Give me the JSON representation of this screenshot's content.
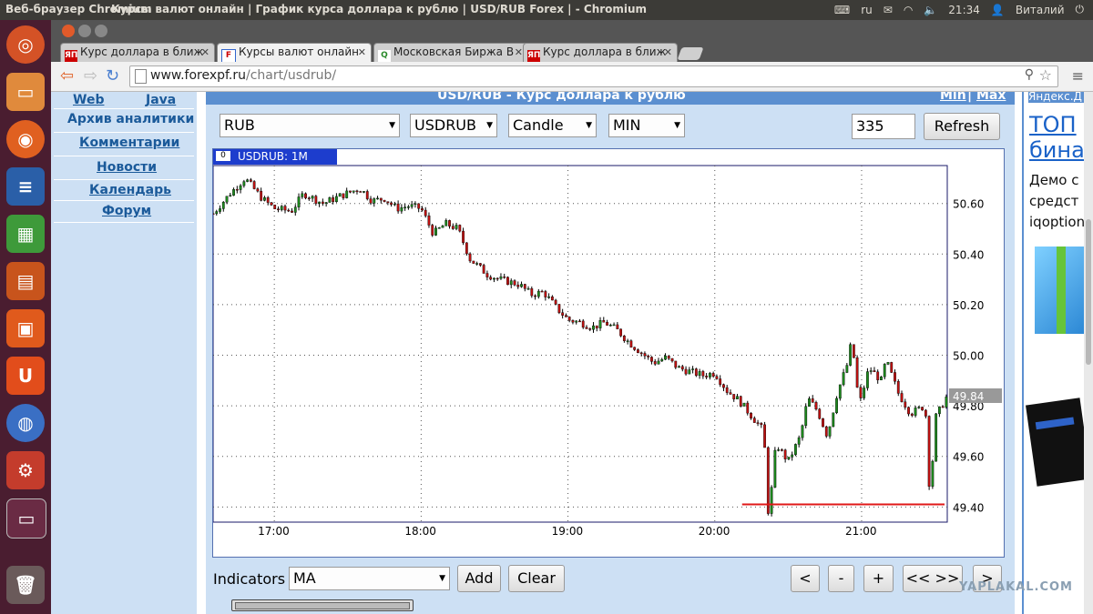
{
  "system_bar": {
    "app_name": "Веб-браузер Chromium",
    "window_title": "Курсы валют онлайн | График курса доллара к рублю | USD/RUB Forex | - Chromium",
    "keyboard_layout": "ru",
    "time": "21:34",
    "user": "Виталий"
  },
  "tabs": [
    {
      "favicon": "ЯП",
      "label": "Курс доллара в ближ",
      "active": false
    },
    {
      "favicon": "F",
      "label": "Курсы валют онлайн",
      "active": true
    },
    {
      "favicon": "Q",
      "label": "Московская Биржа В",
      "active": false
    },
    {
      "favicon": "ЯП",
      "label": "Курс доллара в ближ",
      "active": false
    }
  ],
  "address": {
    "domain": "www.forexpf.ru",
    "path": "/chart/usdrub/"
  },
  "left_nav": {
    "tab_web": "Web",
    "tab_java": "Java",
    "items": [
      "Архив аналитики",
      "Комментарии",
      "Новости",
      "Календарь",
      "Форум"
    ]
  },
  "chart_header": {
    "title": "USD/RUB - Курс доллара к рублю",
    "min_link": "Min",
    "separator": "|",
    "max_link": "Max"
  },
  "controls": {
    "currency": "RUB",
    "symbol": "USDRUB",
    "chart_kind": "Candle",
    "interval": "MIN",
    "count": "335",
    "refresh": "Refresh",
    "indicators_label": "Indicators",
    "indicator": "MA",
    "add": "Add",
    "clear": "Clear",
    "nav_prev": "<",
    "nav_zoom_out": "-",
    "nav_zoom_in": "+",
    "nav_fit": "<< >>",
    "nav_next": ">"
  },
  "chart_data": {
    "type": "candlestick",
    "title": "USDRUB: 1M",
    "x_ticks": [
      "17:00",
      "18:00",
      "19:00",
      "20:00",
      "21:00"
    ],
    "y_ticks": [
      "50.60",
      "50.40",
      "50.20",
      "50.00",
      "49.80",
      "49.60",
      "49.40"
    ],
    "ylim": [
      49.34,
      50.75
    ],
    "x_range": [
      "16:35",
      "21:35"
    ],
    "current_price": "49.84",
    "support_line": 49.41,
    "grid": true,
    "close_path": [
      [
        "16:35",
        50.56
      ],
      [
        "16:42",
        50.64
      ],
      [
        "16:48",
        50.7
      ],
      [
        "16:55",
        50.62
      ],
      [
        "17:00",
        50.58
      ],
      [
        "17:07",
        50.57
      ],
      [
        "17:12",
        50.64
      ],
      [
        "17:20",
        50.6
      ],
      [
        "17:27",
        50.63
      ],
      [
        "17:35",
        50.66
      ],
      [
        "17:40",
        50.61
      ],
      [
        "17:45",
        50.62
      ],
      [
        "17:50",
        50.58
      ],
      [
        "17:55",
        50.59
      ],
      [
        "18:00",
        50.58
      ],
      [
        "18:05",
        50.48
      ],
      [
        "18:10",
        50.52
      ],
      [
        "18:15",
        50.5
      ],
      [
        "18:20",
        50.38
      ],
      [
        "18:27",
        50.32
      ],
      [
        "18:32",
        50.3
      ],
      [
        "18:40",
        50.28
      ],
      [
        "18:45",
        50.24
      ],
      [
        "18:50",
        50.25
      ],
      [
        "18:55",
        50.19
      ],
      [
        "19:00",
        50.14
      ],
      [
        "19:05",
        50.13
      ],
      [
        "19:10",
        50.11
      ],
      [
        "19:15",
        50.13
      ],
      [
        "19:20",
        50.1
      ],
      [
        "19:25",
        50.05
      ],
      [
        "19:30",
        50.01
      ],
      [
        "19:35",
        49.97
      ],
      [
        "19:40",
        49.99
      ],
      [
        "19:45",
        49.95
      ],
      [
        "19:55",
        49.92
      ],
      [
        "20:00",
        49.93
      ],
      [
        "20:05",
        49.86
      ],
      [
        "20:10",
        49.82
      ],
      [
        "20:15",
        49.76
      ],
      [
        "20:20",
        49.7
      ],
      [
        "20:22",
        49.35
      ],
      [
        "20:25",
        49.65
      ],
      [
        "20:30",
        49.58
      ],
      [
        "20:35",
        49.68
      ],
      [
        "20:38",
        49.83
      ],
      [
        "20:42",
        49.78
      ],
      [
        "20:46",
        49.68
      ],
      [
        "20:50",
        49.85
      ],
      [
        "20:54",
        49.96
      ],
      [
        "20:56",
        50.06
      ],
      [
        "20:59",
        49.8
      ],
      [
        "21:03",
        49.95
      ],
      [
        "21:08",
        49.9
      ],
      [
        "21:10",
        49.98
      ],
      [
        "21:15",
        49.85
      ],
      [
        "21:20",
        49.77
      ],
      [
        "21:26",
        49.8
      ],
      [
        "21:28",
        49.42
      ],
      [
        "21:30",
        49.75
      ],
      [
        "21:35",
        49.84
      ]
    ]
  },
  "right_ad": {
    "header": "Яндекс.Д",
    "headline": "ТОП\nбина",
    "body": "Демо с\nсредст\niqoption"
  },
  "watermark": "YAPLAKAL.COM"
}
